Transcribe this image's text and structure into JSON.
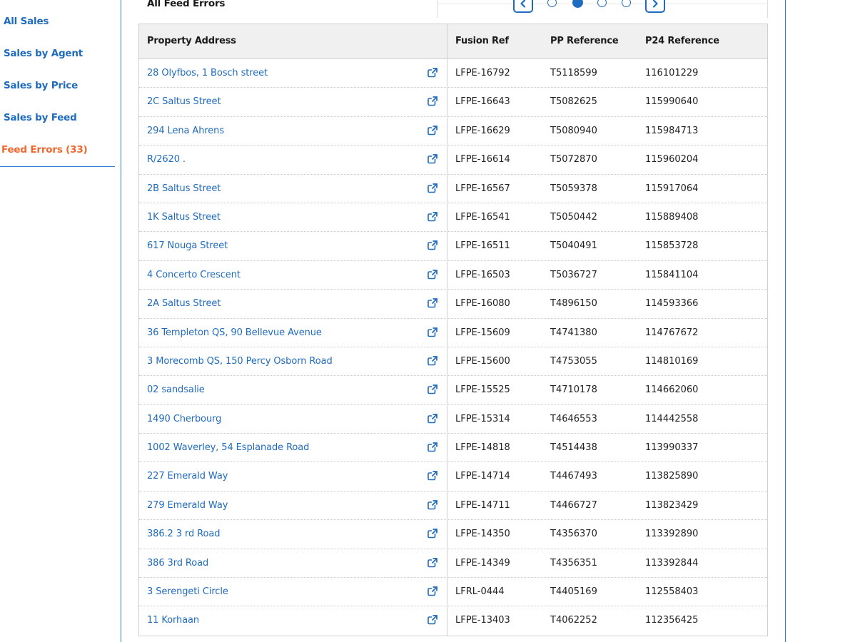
{
  "sidebar": {
    "items": [
      {
        "label": "All Sales",
        "active": false
      },
      {
        "label": "Sales by Agent",
        "active": false
      },
      {
        "label": "Sales by Price",
        "active": false
      },
      {
        "label": "Sales by Feed",
        "active": false
      },
      {
        "label": "Feed Errors (33)",
        "active": true
      }
    ]
  },
  "main": {
    "title": "All Feed Errors",
    "pagination": {
      "pages": 4,
      "current": 2
    }
  },
  "table": {
    "headers": {
      "address": "Property Address",
      "fusion": "Fusion Ref",
      "pp": "PP Reference",
      "p24": "P24 Reference"
    },
    "rows": [
      {
        "address": "28 Olyfbos, 1 Bosch street",
        "fusion": "LFPE-16792",
        "pp": "T5118599",
        "p24": "116101229"
      },
      {
        "address": "2C Saltus Street",
        "fusion": "LFPE-16643",
        "pp": "T5082625",
        "p24": "115990640"
      },
      {
        "address": "294 Lena Ahrens",
        "fusion": "LFPE-16629",
        "pp": "T5080940",
        "p24": "115984713"
      },
      {
        "address": "R/2620 .",
        "fusion": "LFPE-16614",
        "pp": "T5072870",
        "p24": "115960204"
      },
      {
        "address": "2B Saltus Street",
        "fusion": "LFPE-16567",
        "pp": "T5059378",
        "p24": "115917064"
      },
      {
        "address": "1K Saltus Street",
        "fusion": "LFPE-16541",
        "pp": "T5050442",
        "p24": "115889408"
      },
      {
        "address": "617 Nouga Street",
        "fusion": "LFPE-16511",
        "pp": "T5040491",
        "p24": "115853728"
      },
      {
        "address": "4 Concerto Crescent",
        "fusion": "LFPE-16503",
        "pp": "T5036727",
        "p24": "115841104"
      },
      {
        "address": "2A Saltus Street",
        "fusion": "LFPE-16080",
        "pp": "T4896150",
        "p24": "114593366"
      },
      {
        "address": "36 Templeton QS, 90 Bellevue Avenue",
        "fusion": "LFPE-15609",
        "pp": "T4741380",
        "p24": "114767672"
      },
      {
        "address": "3 Morecomb QS, 150 Percy Osborn Road",
        "fusion": "LFPE-15600",
        "pp": "T4753055",
        "p24": "114810169"
      },
      {
        "address": "02 sandsalie",
        "fusion": "LFPE-15525",
        "pp": "T4710178",
        "p24": "114662060"
      },
      {
        "address": "1490 Cherbourg",
        "fusion": "LFPE-15314",
        "pp": "T4646553",
        "p24": "114442558"
      },
      {
        "address": "1002 Waverley, 54 Esplanade Road",
        "fusion": "LFPE-14818",
        "pp": "T4514438",
        "p24": "113990337"
      },
      {
        "address": "227 Emerald Way",
        "fusion": "LFPE-14714",
        "pp": "T4467493",
        "p24": "113825890"
      },
      {
        "address": "279 Emerald Way",
        "fusion": "LFPE-14711",
        "pp": "T4466727",
        "p24": "113823429"
      },
      {
        "address": "386.2 3 rd Road",
        "fusion": "LFPE-14350",
        "pp": "T4356370",
        "p24": "113392890"
      },
      {
        "address": "386 3rd Road",
        "fusion": "LFPE-14349",
        "pp": "T4356351",
        "p24": "113392844"
      },
      {
        "address": "3 Serengeti Circle",
        "fusion": "LFRL-0444",
        "pp": "T4405169",
        "p24": "112558403"
      },
      {
        "address": "11 Korhaan",
        "fusion": "LFPE-13403",
        "pp": "T4062252",
        "p24": "112356425"
      }
    ]
  },
  "icons": {
    "external_link": "external-link-icon",
    "prev": "chevron-left-icon",
    "next": "chevron-right-icon"
  },
  "colors": {
    "link": "#1f6bbf",
    "active_nav": "#f0682e",
    "header_bg": "#f0f0f0",
    "border": "#cfcfcf"
  }
}
